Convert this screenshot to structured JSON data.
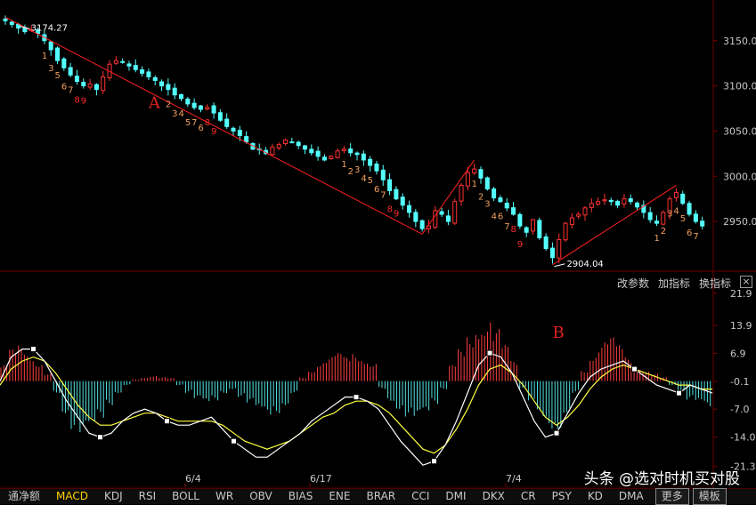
{
  "chart_data": [
    {
      "type": "candlestick",
      "panel": "price",
      "ylim": [
        2895,
        3195
      ],
      "yticks": [
        "3150.00",
        "3100.00",
        "3050.00",
        "3000.00",
        "2950.00"
      ],
      "ytick_values": [
        3150,
        3100,
        3050,
        3000,
        2950
      ],
      "high_label": "3174.27",
      "low_label": "2904.04",
      "annotations": [
        "A",
        "B"
      ],
      "up_color": "#ff3232",
      "down_color": "#54ffff",
      "close_series": [
        3172,
        3168,
        3164,
        3160,
        3162,
        3158,
        3150,
        3140,
        3128,
        3120,
        3112,
        3105,
        3100,
        3102,
        3096,
        3110,
        3124,
        3128,
        3126,
        3122,
        3118,
        3114,
        3110,
        3106,
        3100,
        3096,
        3090,
        3086,
        3080,
        3076,
        3074,
        3076,
        3070,
        3062,
        3055,
        3050,
        3045,
        3038,
        3030,
        3030,
        3025,
        3032,
        3035,
        3040,
        3038,
        3034,
        3030,
        3026,
        3022,
        3018,
        3022,
        3028,
        3030,
        3026,
        3024,
        3018,
        3012,
        3006,
        2996,
        2984,
        2975,
        2968,
        2960,
        2950,
        2942,
        2945,
        2962,
        2958,
        2950,
        2972,
        2990,
        3004,
        3008,
        2998,
        2986,
        2976,
        2972,
        2965,
        2958,
        2945,
        2938,
        2952,
        2932,
        2920,
        2910,
        2930,
        2948,
        2954,
        2958,
        2965,
        2970,
        2972,
        2974,
        2972,
        2968,
        2975,
        2972,
        2966,
        2960,
        2952,
        2948,
        2960,
        2975,
        2982,
        2970,
        2958,
        2950,
        2945
      ],
      "markers": [
        {
          "text": "1"
        },
        {
          "text": "3"
        },
        {
          "text": "5"
        },
        {
          "text": "6"
        },
        {
          "text": "7"
        },
        {
          "text": "8"
        },
        {
          "text": "9"
        },
        {
          "text": "2"
        },
        {
          "text": "3"
        },
        {
          "text": "4"
        },
        {
          "text": "5"
        },
        {
          "text": "7"
        },
        {
          "text": "6"
        },
        {
          "text": "8"
        },
        {
          "text": "9"
        },
        {
          "text": "1"
        },
        {
          "text": "2"
        },
        {
          "text": "3"
        },
        {
          "text": "4"
        },
        {
          "text": "5"
        },
        {
          "text": "6"
        },
        {
          "text": "7"
        },
        {
          "text": "8"
        },
        {
          "text": "9"
        },
        {
          "text": "1"
        },
        {
          "text": "2"
        },
        {
          "text": "3"
        },
        {
          "text": "4"
        },
        {
          "text": "6"
        },
        {
          "text": "7"
        },
        {
          "text": "8"
        },
        {
          "text": "9"
        },
        {
          "text": "1"
        },
        {
          "text": "2"
        },
        {
          "text": "3"
        },
        {
          "text": "4"
        },
        {
          "text": "5"
        },
        {
          "text": "6"
        },
        {
          "text": "7"
        }
      ]
    },
    {
      "type": "bar+line",
      "panel": "MACD",
      "ylim": [
        -22.5,
        23
      ],
      "yticks": [
        "21.9",
        "13.9",
        "6.9",
        "-0.1",
        "-7.0",
        "-14.0",
        "-21.3"
      ],
      "ytick_values": [
        21.9,
        13.9,
        6.9,
        -0.1,
        -7.0,
        -14.0,
        -21.3
      ],
      "xticks": [
        "6/4",
        "6/17",
        "7/4"
      ],
      "histogram": [
        4,
        8,
        9,
        7,
        5,
        2,
        -3,
        -8,
        -12,
        -14,
        -13,
        -10,
        -6,
        -3,
        -1,
        0.5,
        1,
        1.5,
        1,
        0.8,
        -1,
        -3,
        -5,
        -6,
        -5,
        -3,
        -2,
        -4,
        -6,
        -8,
        -9,
        -8,
        -6,
        -3,
        1,
        3,
        5,
        6,
        7,
        6,
        7,
        6,
        5,
        -2,
        -5,
        -7,
        -9,
        -10,
        -9,
        -6,
        -2,
        4,
        8,
        12,
        15,
        16,
        13,
        9,
        5,
        -2,
        -6,
        -10,
        -12,
        -12,
        -8,
        -3,
        3,
        7,
        10,
        11,
        9,
        6,
        4,
        3,
        2,
        1,
        -1,
        -3,
        -5,
        -6,
        -7
      ],
      "dif": [
        0,
        6,
        8,
        8,
        5,
        0,
        -5,
        -9,
        -13,
        -14,
        -13,
        -10,
        -8,
        -7,
        -8,
        -10,
        -11,
        -11,
        -10,
        -9,
        -12,
        -15,
        -17,
        -19,
        -19,
        -17,
        -15,
        -13,
        -10,
        -8,
        -6,
        -4,
        -4,
        -5,
        -7,
        -11,
        -15,
        -18,
        -21,
        -20,
        -16,
        -10,
        -3,
        4,
        7,
        6,
        2,
        -4,
        -10,
        -14,
        -13,
        -8,
        -3,
        1,
        3,
        4,
        5,
        3,
        1,
        -1,
        -2,
        -3,
        -1,
        -2,
        -3
      ],
      "dea": [
        -1,
        3,
        5,
        6,
        5,
        2,
        -2,
        -6,
        -9,
        -11,
        -11,
        -10,
        -9,
        -8,
        -8,
        -9,
        -10,
        -10,
        -10,
        -10,
        -11,
        -13,
        -15,
        -16,
        -17,
        -16,
        -15,
        -13,
        -11,
        -9,
        -8,
        -6,
        -5,
        -5,
        -6,
        -8,
        -11,
        -14,
        -17,
        -18,
        -16,
        -12,
        -7,
        -1,
        3,
        4,
        2,
        -1,
        -5,
        -9,
        -11,
        -9,
        -6,
        -2,
        1,
        3,
        4,
        3,
        2,
        1,
        0,
        -1,
        -1,
        -2,
        -2
      ]
    }
  ],
  "right_toolbar": {
    "edit_params": "改参数",
    "add_indicator": "加指标",
    "swap_indicator": "换指标",
    "close": "×"
  },
  "tabs": [
    {
      "label": "通净额"
    },
    {
      "label": "MACD",
      "active": true
    },
    {
      "label": "KDJ"
    },
    {
      "label": "RSI"
    },
    {
      "label": "BOLL"
    },
    {
      "label": "WR"
    },
    {
      "label": "OBV"
    },
    {
      "label": "BIAS"
    },
    {
      "label": "ENE"
    },
    {
      "label": "BRAR"
    },
    {
      "label": "CCI"
    },
    {
      "label": "DMI"
    },
    {
      "label": "DKX"
    },
    {
      "label": "CR"
    },
    {
      "label": "PSY"
    },
    {
      "label": "KD"
    },
    {
      "label": "DMA"
    },
    {
      "label": "更多",
      "boxed": true
    },
    {
      "label": "模板",
      "boxed": true
    }
  ],
  "watermark": "头条 @选对时机买对股"
}
